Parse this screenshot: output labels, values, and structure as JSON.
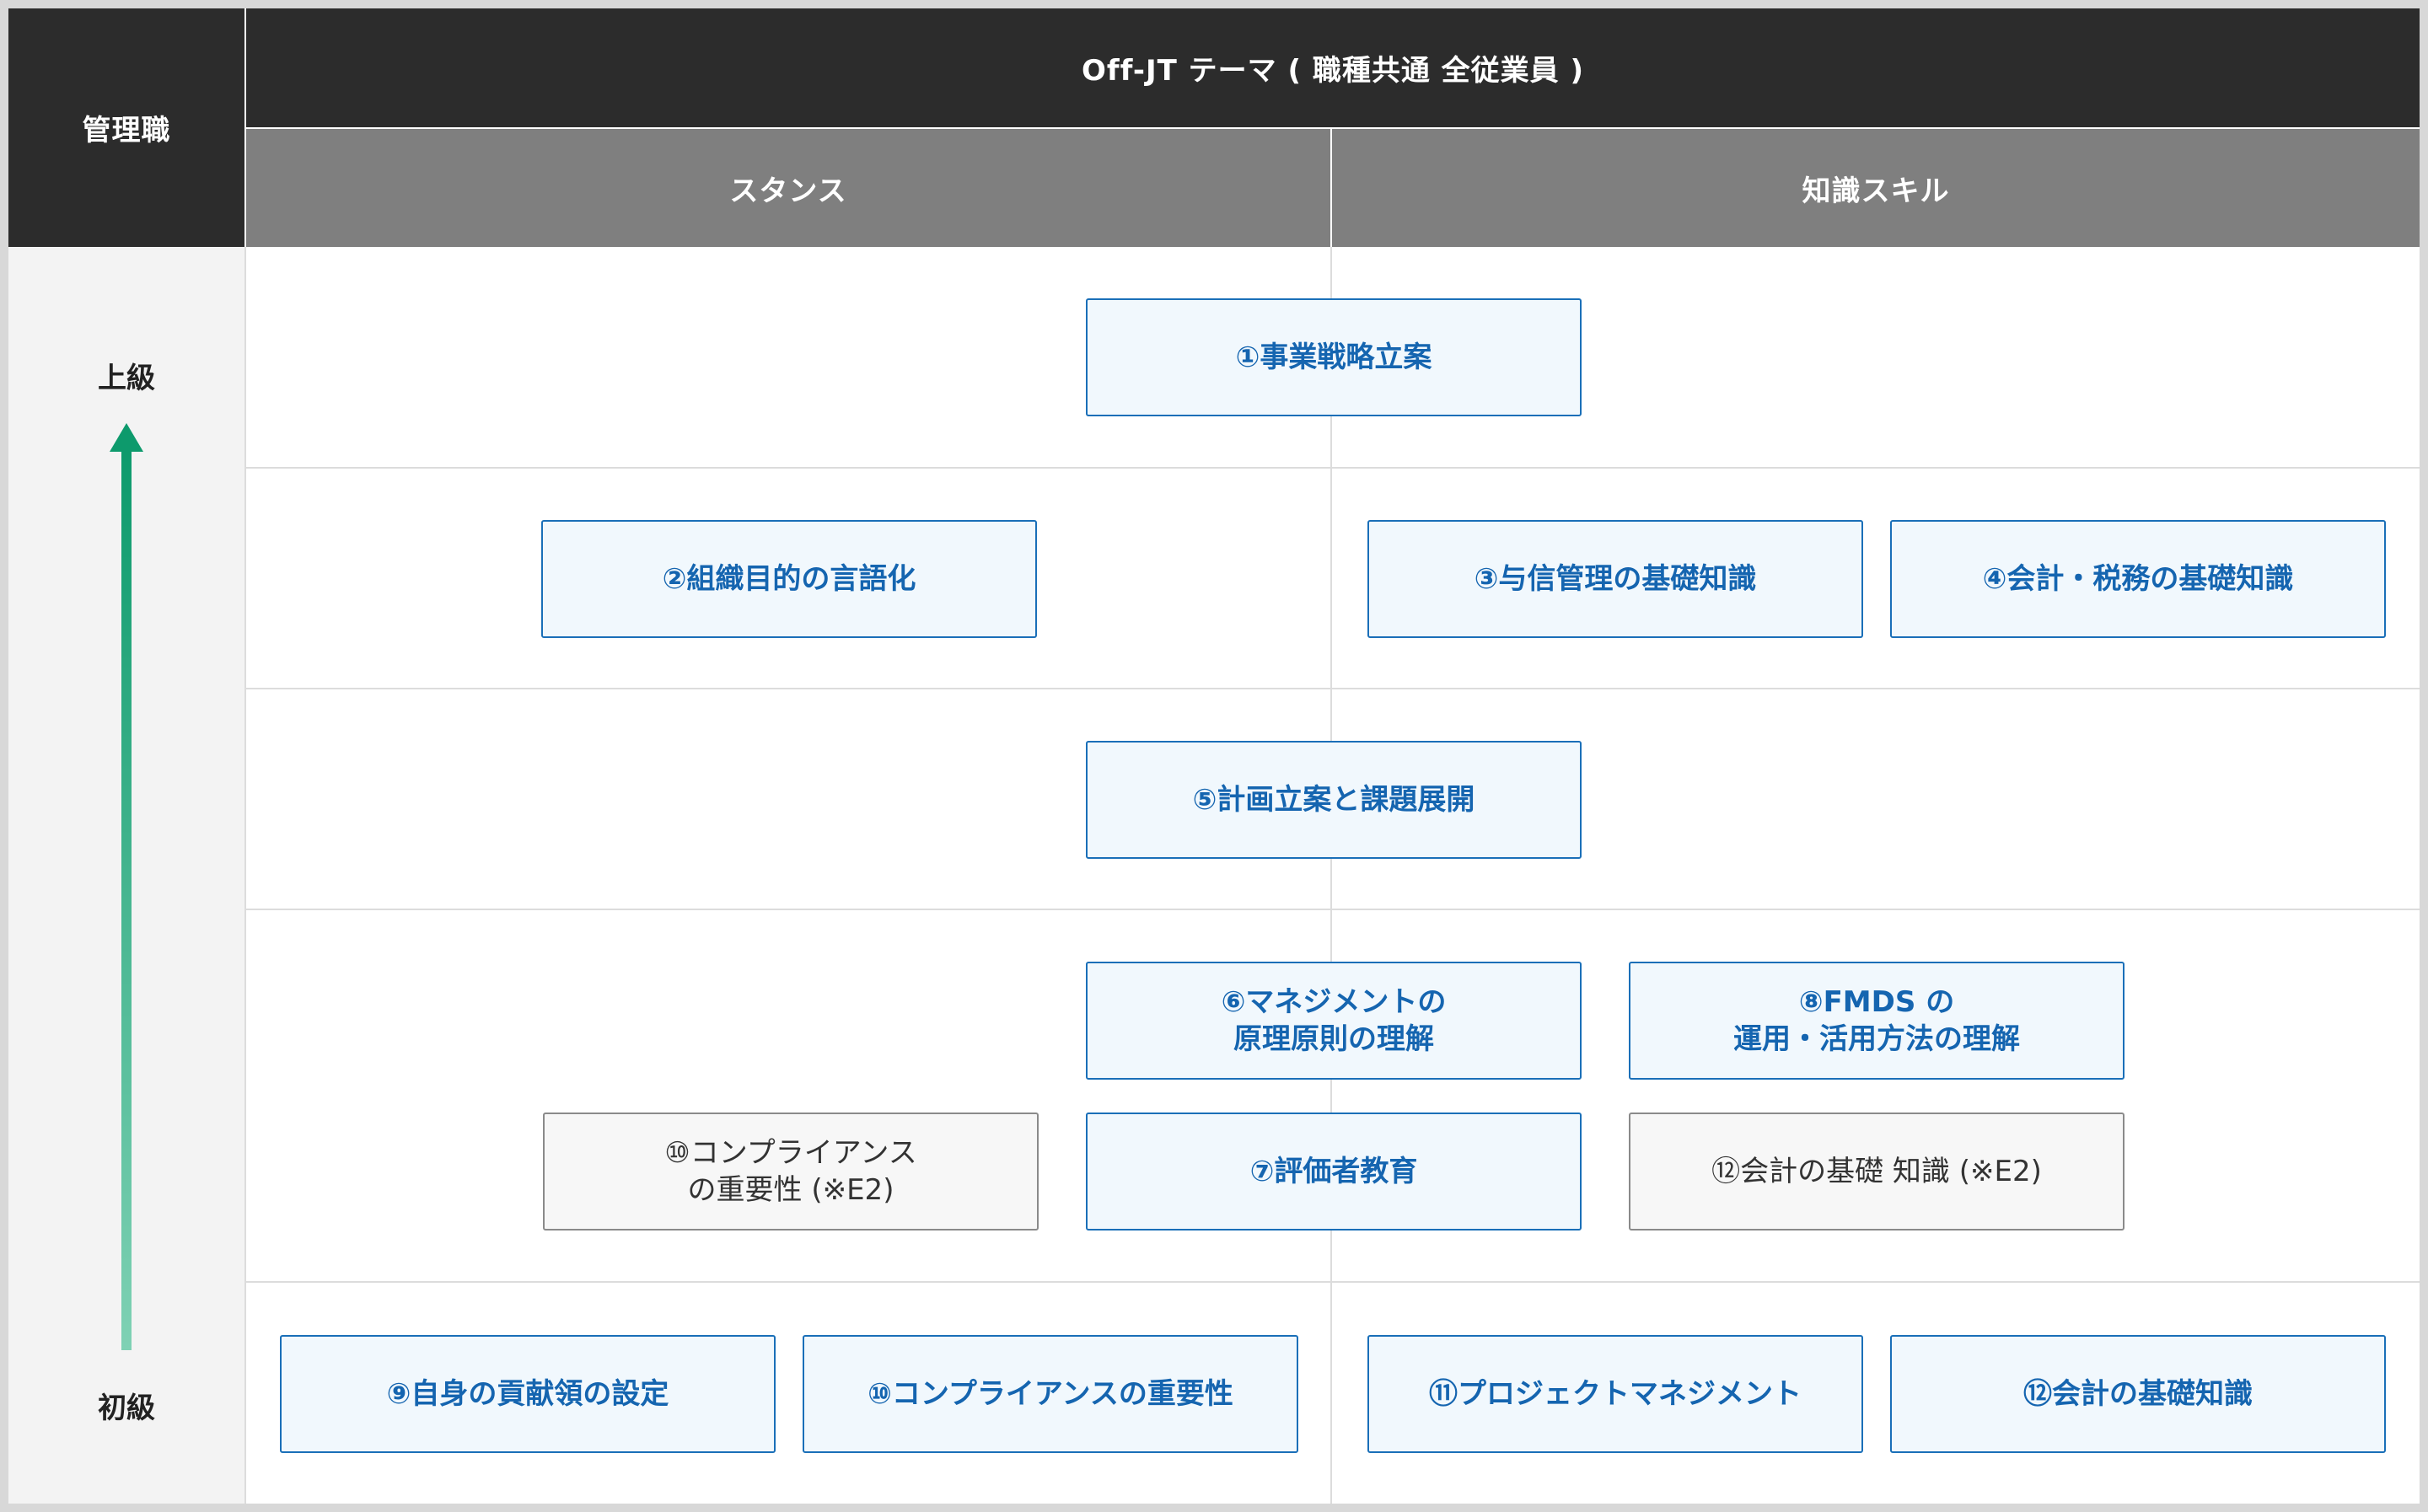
{
  "header": {
    "corner_label": "管理職",
    "title": "Off-JT テーマ ( 職種共通 全従業員 )",
    "columns": [
      "スタンス",
      "知識スキル"
    ]
  },
  "levels": {
    "top": "上級",
    "bottom": "初級"
  },
  "colors": {
    "header_dark": "#2c2c2c",
    "header_gray": "#7f7f7f",
    "box_border_blue": "#1a6fb8",
    "box_text_blue": "#1565b0",
    "arrow_top": "#0d9a6c",
    "arrow_bottom": "#7fd1b4"
  },
  "topics": {
    "t1": "①事業戦略立案",
    "t2": "②組織目的の言語化",
    "t3": "③与信管理の基礎知識",
    "t4": "④会計・税務の基礎知識",
    "t5": "⑤計画立案と課題展開",
    "t6": "⑥マネジメントの\n原理原則の理解",
    "t7": "⑦評価者教育",
    "t8": "⑧FMDS の\n運用・活用方法の理解",
    "t9": "⑨自身の貢献領の設定",
    "t10": "⑩コンプライアンスの重要性",
    "t10b": "⑩コンプライアンス\nの重要性 (※E2)",
    "t11": "⑪プロジェクトマネジメント",
    "t12": "⑫会計の基礎知識",
    "t12b": "⑫会計の基礎 知識 (※E2)"
  }
}
